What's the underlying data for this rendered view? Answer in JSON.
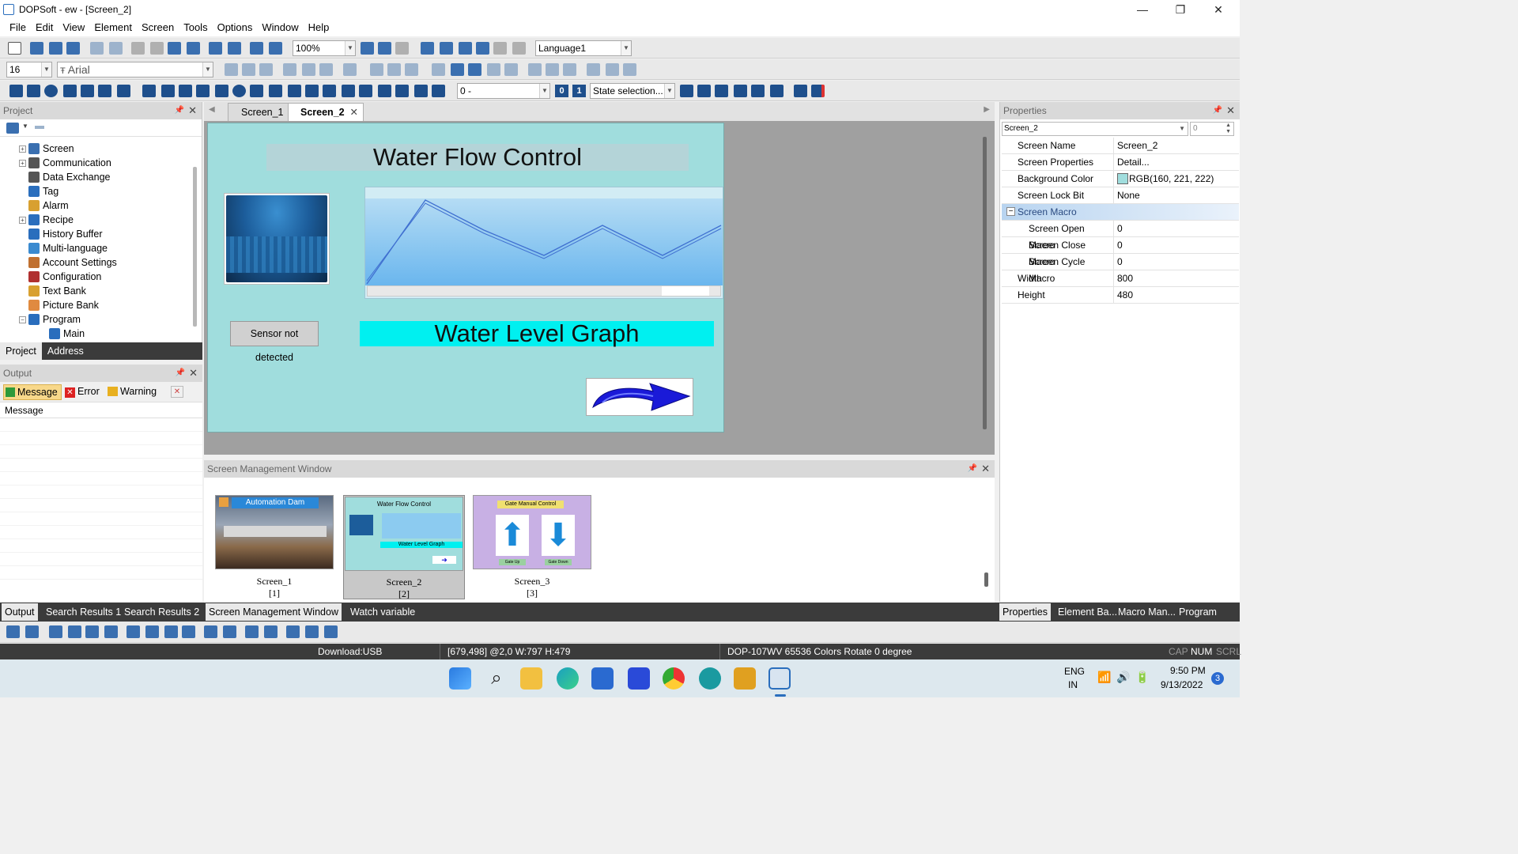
{
  "window": {
    "title": "DOPSoft - ew - [Screen_2]",
    "controls": {
      "minimize": "—",
      "restore": "❐",
      "close": "✕"
    }
  },
  "menu": [
    "File",
    "Edit",
    "View",
    "Element",
    "Screen",
    "Tools",
    "Options",
    "Window",
    "Help"
  ],
  "toolbar": {
    "zoom": "100%",
    "language": "Language1",
    "font_size": "16",
    "font_name": "Arial",
    "state_value": "0 -",
    "state_selection": "State selection...",
    "state_btn_0": "0",
    "state_btn_1": "1"
  },
  "project_panel": {
    "title": "Project",
    "tree": [
      {
        "label": "Screen",
        "expandable": true
      },
      {
        "label": "Communication",
        "expandable": true
      },
      {
        "label": "Data Exchange",
        "expandable": false
      },
      {
        "label": "Tag",
        "expandable": false
      },
      {
        "label": "Alarm",
        "expandable": false
      },
      {
        "label": "Recipe",
        "expandable": true
      },
      {
        "label": "History Buffer",
        "expandable": false
      },
      {
        "label": "Multi-language",
        "expandable": false
      },
      {
        "label": "Account Settings",
        "expandable": false
      },
      {
        "label": "Configuration",
        "expandable": false
      },
      {
        "label": "Text Bank",
        "expandable": false
      },
      {
        "label": "Picture Bank",
        "expandable": false
      },
      {
        "label": "Program",
        "expandable": true
      },
      {
        "label": "Main",
        "expandable": false
      }
    ],
    "tabs": [
      "Project",
      "Address"
    ]
  },
  "output_panel": {
    "title": "Output",
    "filters": {
      "message": "Message",
      "error": "Error",
      "warning": "Warning"
    },
    "column": "Message"
  },
  "editor": {
    "tabs": [
      "Screen_1",
      "Screen_2"
    ],
    "active_tab": "Screen_2",
    "screen": {
      "title": "Water Flow Control",
      "sensor_label": "Sensor not detected",
      "graph_label": "Water Level Graph",
      "bg_color": "#a0dddd"
    }
  },
  "screen_mgmt": {
    "title": "Screen Management Window",
    "thumbs": [
      {
        "name": "Screen_1",
        "index": "[1]",
        "caption": "Automation Dam"
      },
      {
        "name": "Screen_2",
        "index": "[2]",
        "caption": "Water Flow Control",
        "caption2": "Water Level Graph"
      },
      {
        "name": "Screen_3",
        "index": "[3]",
        "caption": "Gate Manual Control",
        "btn1": "Gate Up",
        "btn2": "Gate Down"
      }
    ]
  },
  "properties": {
    "title": "Properties",
    "selector": "Screen_2",
    "selector_num": "0",
    "rows": [
      {
        "key": "Screen Name",
        "value": "Screen_2"
      },
      {
        "key": "Screen Properties",
        "value": "Detail..."
      },
      {
        "key": "Background Color",
        "value": "RGB(160, 221, 222)"
      },
      {
        "key": "Screen Lock Bit",
        "value": "None"
      },
      {
        "key": "Screen Macro",
        "value": ""
      },
      {
        "key": "Screen Open Macro",
        "value": "0"
      },
      {
        "key": "Screen Close Macro",
        "value": "0"
      },
      {
        "key": "Screen Cycle Macro",
        "value": "0"
      },
      {
        "key": "Width",
        "value": "800"
      },
      {
        "key": "Height",
        "value": "480"
      }
    ],
    "bottom_tabs": [
      "Properties",
      "Element Ba...",
      "Macro Man...",
      "Program ex..."
    ]
  },
  "bottom_tabs_left": [
    "Output",
    "Search Results 1",
    "Search Results 2"
  ],
  "bottom_tabs_mid": [
    "Screen Management Window",
    "Watch variable"
  ],
  "status": {
    "download": "Download:USB",
    "coords": "[679,498] @2,0 W:797 H:479",
    "device": "DOP-107WV 65536 Colors Rotate 0 degree",
    "cap": "CAP",
    "num": "NUM",
    "scrl": "SCRL"
  },
  "taskbar": {
    "lang1": "ENG",
    "lang2": "IN",
    "time": "9:50 PM",
    "date": "9/13/2022",
    "badge": "3"
  },
  "colors": {
    "screen_bg": "#a0dddd",
    "graph_label_bg": "#00f0f0",
    "accent": "#2a6ebd"
  }
}
